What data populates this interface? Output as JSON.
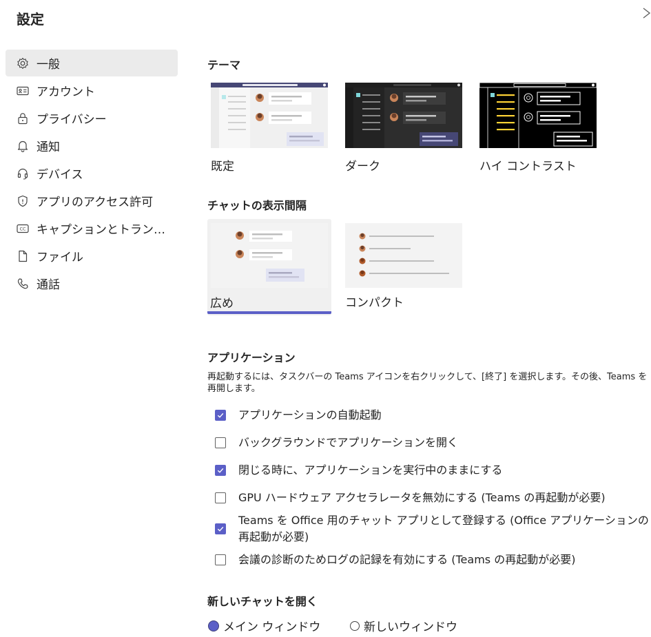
{
  "header": {
    "title": "設定",
    "close_icon": "close-icon"
  },
  "sidebar": {
    "items": [
      {
        "label": "一般",
        "icon": "gear-icon",
        "selected": true
      },
      {
        "label": "アカウント",
        "icon": "id-card-icon"
      },
      {
        "label": "プライバシー",
        "icon": "lock-icon"
      },
      {
        "label": "通知",
        "icon": "bell-icon"
      },
      {
        "label": "デバイス",
        "icon": "headset-icon"
      },
      {
        "label": "アプリのアクセス許可",
        "icon": "shield-icon"
      },
      {
        "label": "キャプションとトラン…",
        "icon": "cc-icon"
      },
      {
        "label": "ファイル",
        "icon": "file-icon"
      },
      {
        "label": "通話",
        "icon": "phone-icon"
      }
    ]
  },
  "theme": {
    "title": "テーマ",
    "options": [
      {
        "label": "既定"
      },
      {
        "label": "ダーク"
      },
      {
        "label": "ハイ コントラスト"
      }
    ]
  },
  "density": {
    "title": "チャットの表示間隔",
    "options": [
      {
        "label": "広め",
        "selected": true
      },
      {
        "label": "コンパクト"
      }
    ]
  },
  "application": {
    "title": "アプリケーション",
    "description": "再起動するには、タスクバーの Teams アイコンを右クリックして、[終了] を選択します。その後、Teams を再開します。",
    "options": [
      {
        "label": "アプリケーションの自動起動",
        "checked": true
      },
      {
        "label": "バックグラウンドでアプリケーションを開く",
        "checked": false
      },
      {
        "label": "閉じる時に、アプリケーションを実行中のままにする",
        "checked": true
      },
      {
        "label": "GPU ハードウェア アクセラレータを無効にする (Teams の再起動が必要)",
        "checked": false
      },
      {
        "label": "Teams を Office 用のチャット アプリとして登録する (Office アプリケーションの再起動が必要)",
        "checked": true
      },
      {
        "label": "会議の診断のためログの記録を有効にする (Teams の再起動が必要)",
        "checked": false
      }
    ]
  },
  "open_chat": {
    "title": "新しいチャットを開く",
    "options": [
      {
        "label": "メイン ウィンドウ",
        "selected": true
      },
      {
        "label": "新しいウィンドウ",
        "selected": false
      }
    ]
  },
  "colors": {
    "accent": "#5b5fc7",
    "selected_bg": "#ebebeb"
  }
}
